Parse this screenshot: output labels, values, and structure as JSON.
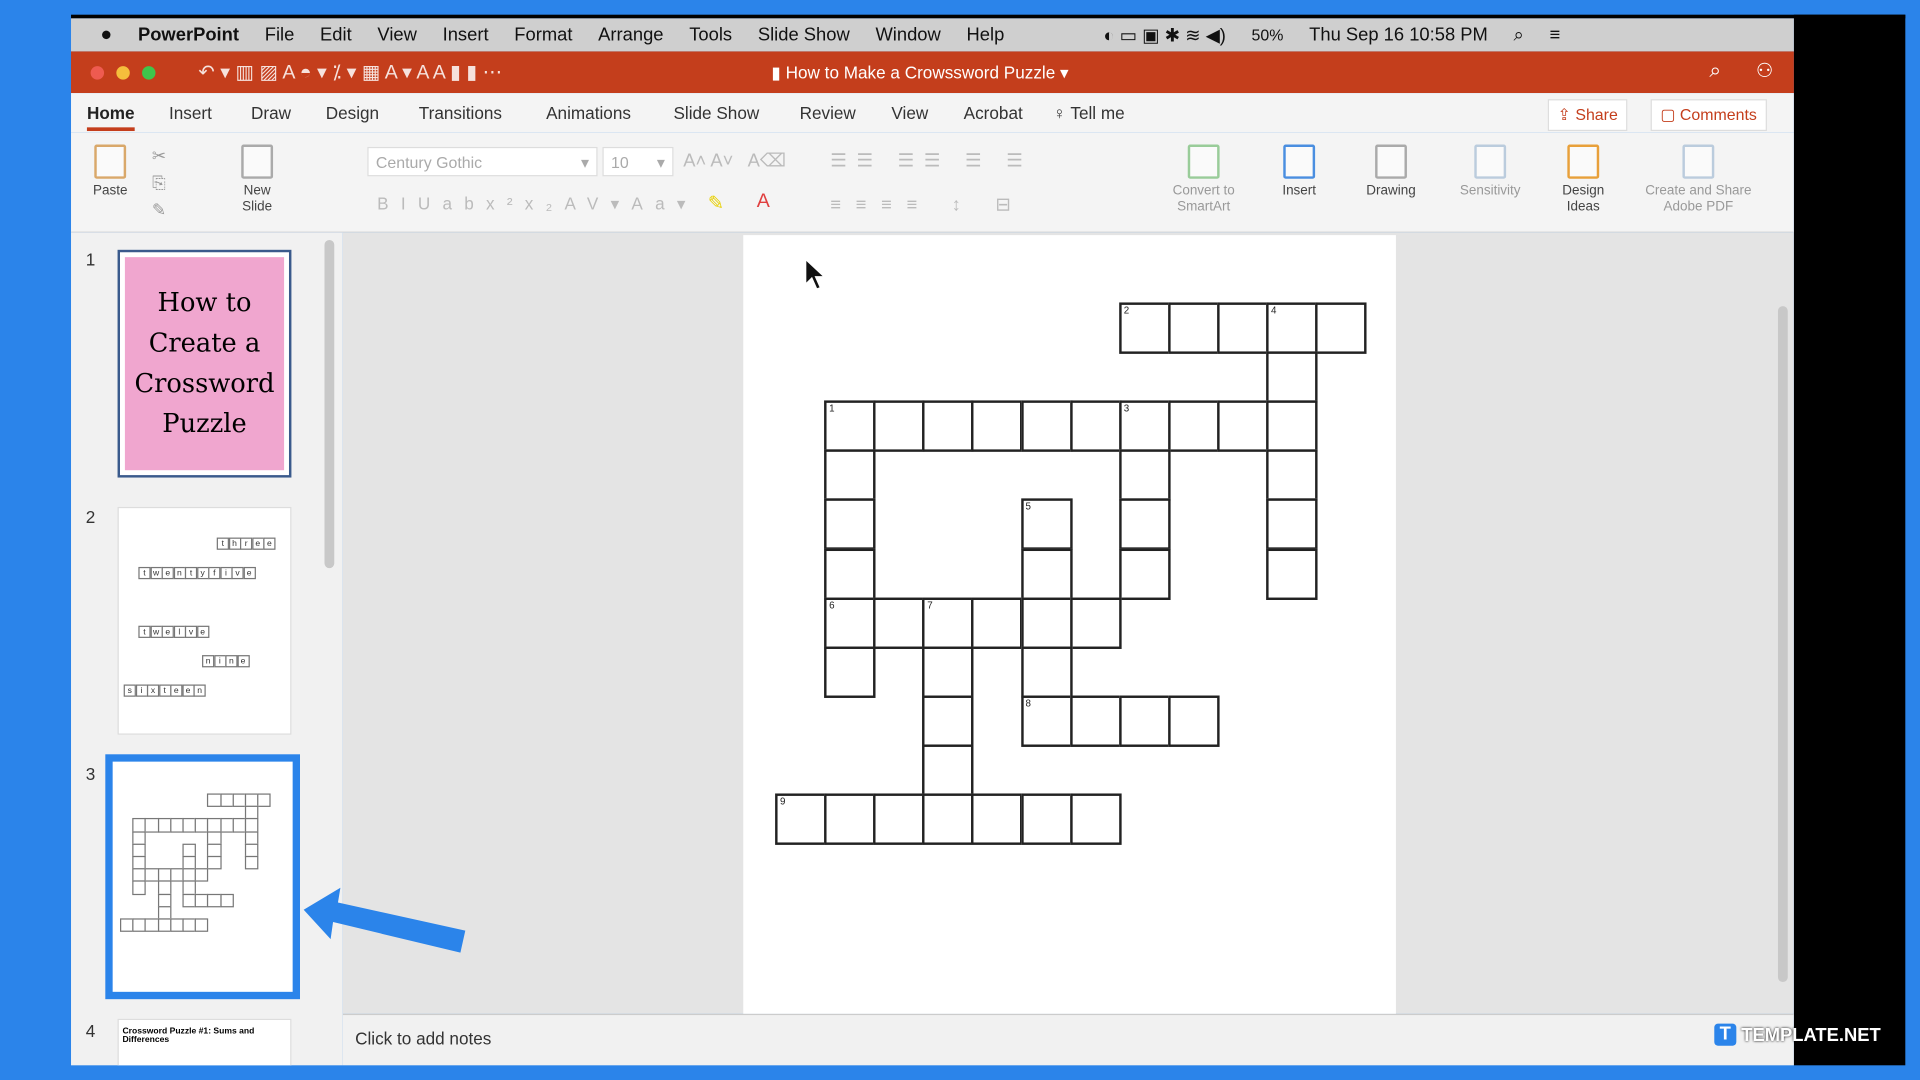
{
  "menubar": {
    "app": "PowerPoint",
    "items": [
      "File",
      "Edit",
      "View",
      "Insert",
      "Format",
      "Arrange",
      "Tools",
      "Slide Show",
      "Window",
      "Help"
    ],
    "battery": "50%",
    "datetime": "Thu Sep 16  10:58 PM"
  },
  "titlebar": {
    "title": "How to Make a Crowssword Puzzle"
  },
  "tabs": [
    "Home",
    "Insert",
    "Draw",
    "Design",
    "Transitions",
    "Animations",
    "Slide Show",
    "Review",
    "View",
    "Acrobat"
  ],
  "tell_me": "Tell me",
  "share": "Share",
  "comments": "Comments",
  "ribbon": {
    "paste": "Paste",
    "new_slide": "New Slide",
    "font": "Century Gothic",
    "size": "10",
    "convert": "Convert to SmartArt",
    "insert": "Insert",
    "drawing": "Drawing",
    "sensitivity": "Sensitivity",
    "design_ideas": "Design Ideas",
    "create_share": "Create and Share Adobe PDF"
  },
  "slides": [
    {
      "num": "1",
      "title": "How to Create a Crossword Puzzle",
      "color": "#f0a6cf"
    },
    {
      "num": "2",
      "words": [
        "three",
        "twentyfive",
        "twelve",
        "nine",
        "sixteen"
      ]
    },
    {
      "num": "3"
    },
    {
      "num": "4",
      "title": "Crossword Puzzle #1: Sums and Differences"
    }
  ],
  "crossword": {
    "grid": [
      ".......#####",
      "..........#.",
      ".##########.",
      ".#.....#..#.",
      ".#...#.#..#.",
      ".#...#.#..#.",
      ".######.....",
      ".#.#.#......",
      "...#.####...",
      "...#........",
      "#######....."
    ],
    "numbers": {
      "0,7": "2",
      "0,10": "4",
      "2,1": "1",
      "2,7": "3",
      "4,5": "5",
      "6,1": "6",
      "6,3": "7",
      "8,5": "8",
      "10,0": "9"
    }
  },
  "notes_placeholder": "Click to add notes",
  "watermark": "TEMPLATE.NET",
  "accent": "#2b84ea"
}
